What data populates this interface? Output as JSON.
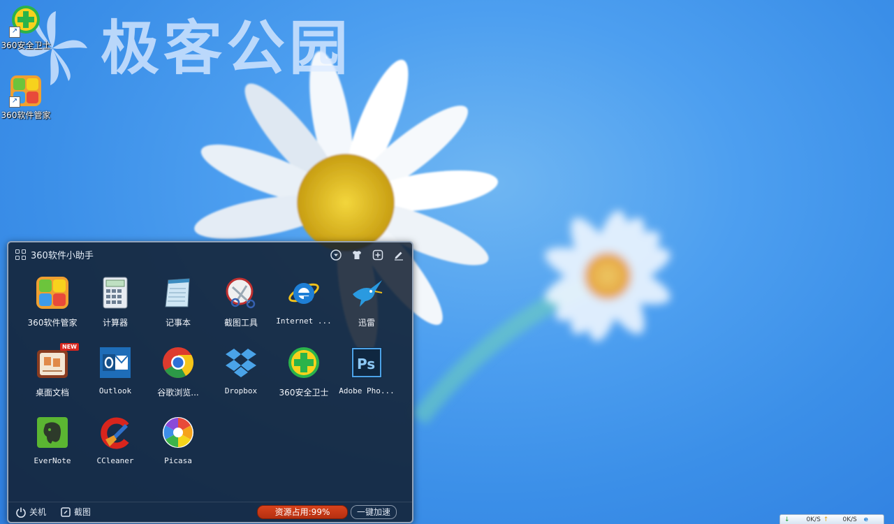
{
  "watermark": {
    "text": "极客公园"
  },
  "desktop": {
    "icons": [
      {
        "label": "360安全卫士",
        "icon": "360-safe-guard-icon"
      },
      {
        "label": "360软件管家",
        "icon": "360-software-manager-icon"
      }
    ]
  },
  "panel": {
    "title": "360软件小助手",
    "tools": [
      "dropdown-icon",
      "skin-icon",
      "add-icon",
      "edit-icon"
    ],
    "apps": [
      {
        "label": "360软件管家",
        "icon": "360-software-manager-icon"
      },
      {
        "label": "计算器",
        "icon": "calculator-icon"
      },
      {
        "label": "记事本",
        "icon": "notepad-icon"
      },
      {
        "label": "截图工具",
        "icon": "snipping-tool-icon"
      },
      {
        "label": "Internet ...",
        "icon": "internet-explorer-icon"
      },
      {
        "label": "迅雷",
        "icon": "xunlei-icon"
      },
      {
        "label": "桌面文档",
        "icon": "desktop-docs-icon",
        "badge": "NEW"
      },
      {
        "label": "Outlook",
        "icon": "outlook-icon"
      },
      {
        "label": "谷歌浏览...",
        "icon": "chrome-icon"
      },
      {
        "label": "Dropbox",
        "icon": "dropbox-icon"
      },
      {
        "label": "360安全卫士",
        "icon": "360-safe-guard-icon"
      },
      {
        "label": "Adobe Pho...",
        "icon": "photoshop-icon"
      },
      {
        "label": "EverNote",
        "icon": "evernote-icon"
      },
      {
        "label": "CCleaner",
        "icon": "ccleaner-icon"
      },
      {
        "label": "Picasa",
        "icon": "picasa-icon"
      }
    ],
    "footer": {
      "shutdown_label": "关机",
      "screenshot_label": "截图",
      "usage_text": "资源占用:99%",
      "boost_label": "一键加速"
    }
  },
  "netspeed": {
    "down": "0K/S",
    "up": "0K/S"
  },
  "colors": {
    "desktop_bg": "#3b8fe8",
    "panel_bg": "#121e30",
    "usage_pill": "#c83a16"
  }
}
